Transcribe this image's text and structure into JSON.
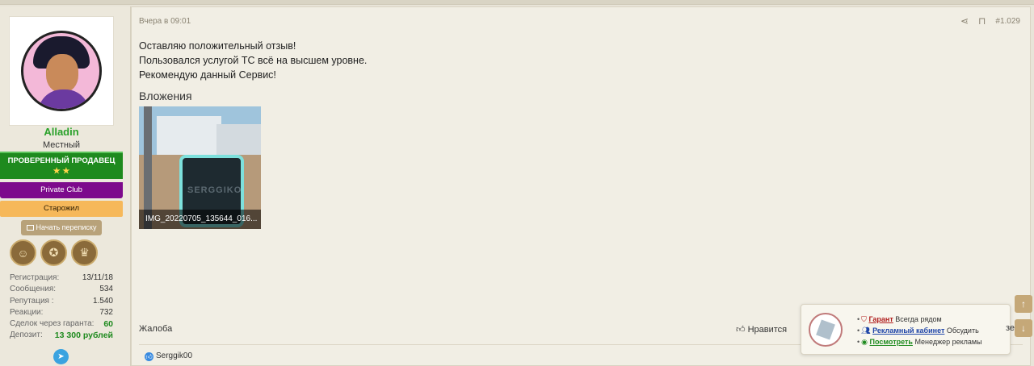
{
  "user": {
    "name": "Alladin",
    "title": "Местный",
    "banners": {
      "verified": "ПРОВЕРЕННЫЙ ПРОДАВЕЦ",
      "verified_stars": "★ ★",
      "private": "Private Club",
      "oldtimer": "Старожил"
    },
    "message_button": "Начать переписку",
    "stats": [
      {
        "label": "Регистрация:",
        "value": "13/11/18"
      },
      {
        "label": "Сообщения:",
        "value": "534"
      },
      {
        "label": "Репутация :",
        "value": "1.540"
      },
      {
        "label": "Реакции:",
        "value": "732"
      },
      {
        "label": "Сделок через гаранта:",
        "value": "60"
      },
      {
        "label": "Депозит:",
        "value": "13 300 рублей"
      }
    ]
  },
  "post": {
    "date": "Вчера в 09:01",
    "number": "#1.029",
    "lines": [
      "Оставляю положительный отзыв!",
      "Пользовался услугой ТС всё на высшем уровне.",
      "Рекомендую данный Сервис!"
    ],
    "attachments_title": "Вложения",
    "attachment_name": "IMG_20220705_135644_016...",
    "attachment_overlay_text": "SERGGIKO",
    "report_label": "Жалоба",
    "like_label": "Нравится",
    "reaction_user": "Serggik00"
  },
  "popup": {
    "lines": [
      {
        "link": "Гарант",
        "text": "Всегда рядом"
      },
      {
        "link": "Рекламный кабинет",
        "text": "Обсудить"
      },
      {
        "link": "Посмотреть",
        "text": "Менеджер рекламы"
      }
    ]
  },
  "partial_text": "зе"
}
